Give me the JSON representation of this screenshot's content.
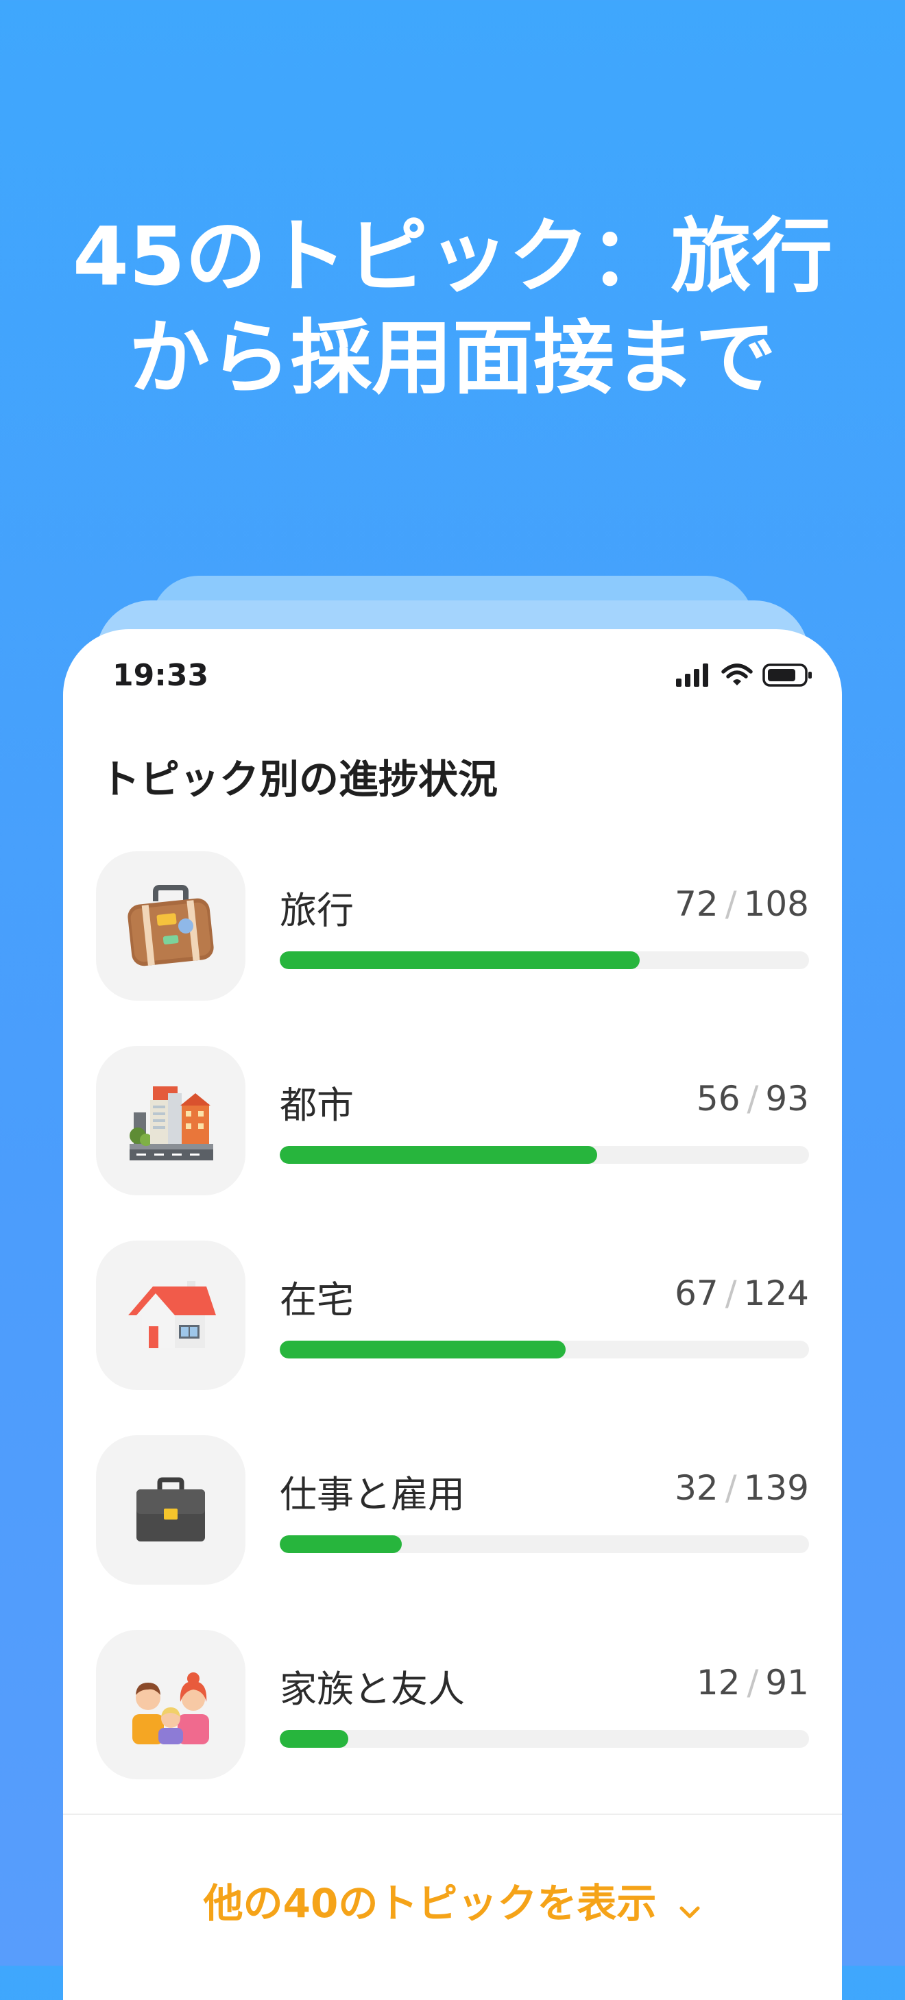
{
  "headline": {
    "line1": "45のトピック：旅行",
    "line2": "から採用面接まで"
  },
  "status_bar": {
    "time": "19:33",
    "icons": [
      "cellular-signal-icon",
      "wifi-icon",
      "battery-icon"
    ]
  },
  "section_title": "トピック別の進捗状況",
  "topics": [
    {
      "name": "旅行",
      "done": "72",
      "slash": "/",
      "total": "108",
      "progress": 0.68,
      "icon": "suitcase-icon"
    },
    {
      "name": "都市",
      "done": "56",
      "slash": "/",
      "total": "93",
      "progress": 0.6,
      "icon": "city-buildings-icon"
    },
    {
      "name": "在宅",
      "done": "67",
      "slash": "/",
      "total": "124",
      "progress": 0.54,
      "icon": "house-icon"
    },
    {
      "name": "仕事と雇用",
      "done": "32",
      "slash": "/",
      "total": "139",
      "progress": 0.23,
      "icon": "briefcase-icon"
    },
    {
      "name": "家族と友人",
      "done": "12",
      "slash": "/",
      "total": "91",
      "progress": 0.13,
      "icon": "family-icon"
    }
  ],
  "show_more": {
    "label": "他の40のトピックを表示",
    "icon": "chevron-down-icon"
  },
  "colors": {
    "background": "#42a3fd",
    "progress_fill": "#27b53d",
    "progress_track": "#f1f1f1",
    "accent_orange": "#f5a318"
  }
}
